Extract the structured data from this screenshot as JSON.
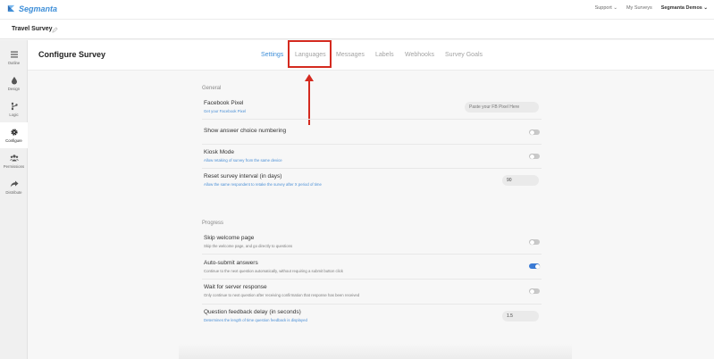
{
  "brand": {
    "name": "Segmanta",
    "color": "#3f8fd8"
  },
  "topbar": {
    "support": "Support ⌄",
    "my_surveys": "My Surveys",
    "account": "Segmanta Demos ⌄"
  },
  "survey": {
    "title": "Travel Survey"
  },
  "sidenav": [
    {
      "label": "Outline",
      "icon": "list-icon"
    },
    {
      "label": "Design",
      "icon": "droplet-icon"
    },
    {
      "label": "Logic",
      "icon": "branch-icon"
    },
    {
      "label": "Configure",
      "icon": "gear-icon",
      "active": true
    },
    {
      "label": "Permissions",
      "icon": "users-icon"
    },
    {
      "label": "Distribute",
      "icon": "share-icon"
    }
  ],
  "page": {
    "title": "Configure Survey"
  },
  "tabs": [
    {
      "label": "Settings",
      "active": true
    },
    {
      "label": "Languages"
    },
    {
      "label": "Messages"
    },
    {
      "label": "Labels"
    },
    {
      "label": "Webhooks"
    },
    {
      "label": "Survey Goals"
    }
  ],
  "general": {
    "title": "General",
    "facebook_pixel": {
      "label": "Facebook Pixel",
      "sub": "Get your Facebook Pixel",
      "placeholder": "Paste your FB Pixel Here"
    },
    "numbering": {
      "label": "Show answer choice numbering",
      "on": false
    },
    "kiosk": {
      "label": "Kiosk Mode",
      "sub": "Allow retaking of survey from the same device",
      "on": false
    },
    "interval": {
      "label": "Reset survey interval (in days)",
      "sub": "Allow the same respondent to retake the survey after X period of time",
      "value": "90"
    }
  },
  "progress": {
    "title": "Progress",
    "skip_welcome": {
      "label": "Skip welcome page",
      "sub": "Skip the welcome page, and go directly to questions",
      "on": false
    },
    "auto_submit": {
      "label": "Auto-submit answers",
      "sub": "Continue to the next question automatically, without requiring a submit button click",
      "on": true
    },
    "wait_server": {
      "label": "Wait for server response",
      "sub": "Only continue to next question after receiving confirmation that response has been received",
      "on": false
    },
    "feedback_delay": {
      "label": "Question feedback delay (in seconds)",
      "sub": "Determines the length of time question feedback is displayed",
      "value": "1.5"
    }
  },
  "colors": {
    "accent": "#3f8fd8",
    "annotation": "#d42a1f",
    "toggle_on": "#3a7bd5"
  }
}
